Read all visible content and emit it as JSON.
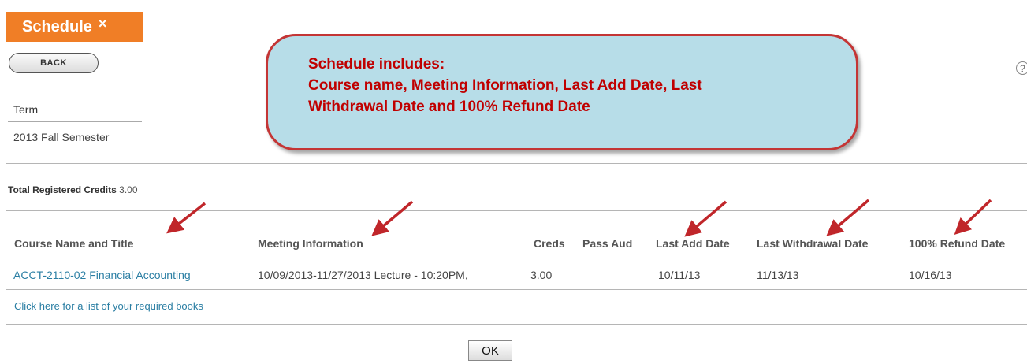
{
  "window": {
    "title": "Schedule",
    "close_glyph": "×"
  },
  "nav": {
    "back_label": "BACK",
    "help_glyph": "?"
  },
  "term": {
    "label": "Term",
    "value": "2013 Fall Semester"
  },
  "credits": {
    "label": "Total Registered Credits",
    "value": "3.00"
  },
  "table": {
    "headers": [
      "Course Name and Title",
      "Meeting Information",
      "Creds",
      "Pass Aud",
      "Last Add Date",
      "Last Withdrawal Date",
      "100% Refund Date"
    ],
    "rows": [
      [
        "ACCT-2110-02 Financial Accounting",
        "10/09/2013-11/27/2013 Lecture - 10:20PM,",
        "3.00",
        "",
        "10/11/13",
        "11/13/13",
        "10/16/13"
      ]
    ]
  },
  "books_link": "Click here for a list of your required books",
  "ok_label": "OK",
  "callout": {
    "lines": [
      "Schedule includes:",
      "Course name, Meeting Information, Last Add Date, Last",
      "Withdrawal Date and 100% Refund Date"
    ]
  },
  "colors": {
    "tab": "#f07e26",
    "callout_fill": "#b7dde8",
    "callout_border": "#c43535",
    "callout_text": "#c00000",
    "arrow": "#c0262a",
    "link": "#2a7ea3"
  },
  "icons": {
    "close": "close-icon",
    "help": "help-icon",
    "annotation": "arrow-icon"
  }
}
